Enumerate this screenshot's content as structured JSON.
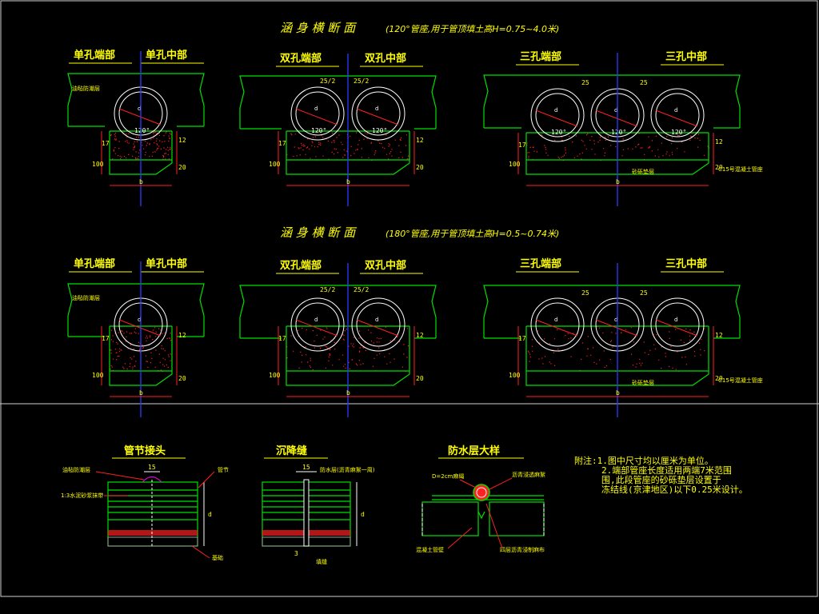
{
  "section_120": {
    "title": "涵 身 横 断 面",
    "subtitle": "(120°管座,用于管顶填土高H=0.75~4.0米)",
    "single_end": "单孔端部",
    "single_mid": "单孔中部",
    "double_end": "双孔端部",
    "double_mid": "双孔中部",
    "triple_end": "三孔端部",
    "triple_mid": "三孔中部",
    "angle": "120°",
    "half_gap": "25/2",
    "gap": "25",
    "dim_100": "100",
    "dim_17": "17",
    "dim_12": "12",
    "dim_20": "20",
    "dim_b": "b",
    "label_waterproof": "油毡防潮层",
    "label_gravel": "砂砾垫层",
    "label_concrete": "C15号混凝土管座",
    "pipe_d": "d",
    "mark_h": "H"
  },
  "section_180": {
    "title": "涵 身 横 断 面",
    "subtitle": "(180°管座,用于管顶填土高H=0.5~0.74米)",
    "single_end": "单孔端部",
    "single_mid": "单孔中部",
    "double_end": "双孔端部",
    "double_mid": "双孔中部",
    "triple_end": "三孔端部",
    "triple_mid": "三孔中部",
    "half_gap": "25/2",
    "gap": "25",
    "dim_100": "100",
    "dim_17": "17",
    "dim_12": "12",
    "dim_20": "20",
    "dim_b": "b",
    "label_waterproof": "油毡防潮层",
    "label_gravel": "砂砾垫层",
    "label_concrete": "C15号混凝土管座",
    "pipe_d": "d"
  },
  "details": {
    "joint_title": "管节接头",
    "settle_title": "沉降缝",
    "waterproof_title": "防水层大样",
    "joint_label_a": "油毡防潮层",
    "joint_label_b": "1:3水泥砂浆抹带",
    "joint_label_c": "管节",
    "joint_label_d": "基础",
    "joint_dim": "15",
    "joint_dim2": "d",
    "settle_label_a": "防水层(沥青麻絮一周)",
    "settle_label_b": "填缝",
    "settle_dim": "15",
    "settle_dim2": "3",
    "settle_dim3": "d",
    "wp_label_top": "D=2cm麻绳",
    "wp_label_right": "沥青浸透麻絮",
    "wp_label_left": "混凝土管壁",
    "wp_label_bottom": "四层沥青浸制麻布"
  },
  "notes": {
    "line1": "附注:1.图中尺寸均以厘米为单位。",
    "line2": "2.端部管座长度适用两端7米范围",
    "line3": "围,此段管座的砂砾垫层设置于",
    "line4": "冻结线(京津地区)以下0.25米设计。"
  },
  "colors": {
    "background": "#000000",
    "text": "#ffff00",
    "outline": "#00e000",
    "pipe": "#ffffff",
    "fill_dots": "#ff2020",
    "centerline": "#2a3cff"
  }
}
